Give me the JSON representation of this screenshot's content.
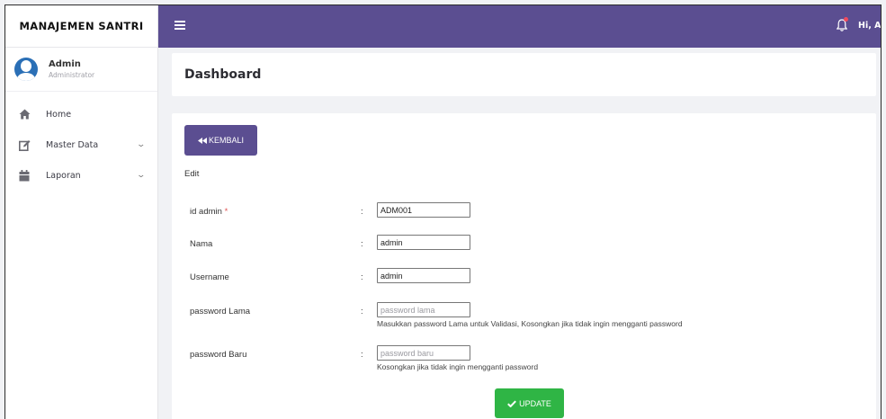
{
  "sidebar": {
    "brand": "MANAJEMEN SANTRI",
    "user_name": "Admin",
    "user_role": "Administrator",
    "items": [
      {
        "label": "Home",
        "icon": "home-icon",
        "has_submenu": false
      },
      {
        "label": "Master Data",
        "icon": "edit-icon",
        "has_submenu": true
      },
      {
        "label": "Laporan",
        "icon": "calendar-icon",
        "has_submenu": true
      }
    ]
  },
  "topbar": {
    "greeting": "Hi, Admin",
    "menu_icon": "hamburger-icon",
    "notification_icon": "bell-icon"
  },
  "page": {
    "title": "Dashboard"
  },
  "form": {
    "back_label": "KEMBALI",
    "heading": "Edit",
    "fields": [
      {
        "label": "id admin",
        "required": true,
        "value": "ADM001",
        "placeholder": "",
        "help": ""
      },
      {
        "label": "Nama",
        "required": false,
        "value": "admin",
        "placeholder": "",
        "help": ""
      },
      {
        "label": "Username",
        "required": false,
        "value": "admin",
        "placeholder": "",
        "help": ""
      },
      {
        "label": "password Lama",
        "required": false,
        "value": "",
        "placeholder": "password lama",
        "help": "Masukkan password Lama untuk Validasi, Kosongkan jika tidak ingin mengganti password"
      },
      {
        "label": "password Baru",
        "required": false,
        "value": "",
        "placeholder": "password baru",
        "help": "Kosongkan jika tidak ingin mengganti password"
      }
    ],
    "required_mark": "*",
    "separator": ":",
    "update_label": "UPDATE"
  },
  "colors": {
    "primary": "#5b4e91",
    "success": "#2fb545",
    "notification_dot": "#f04a5d"
  }
}
